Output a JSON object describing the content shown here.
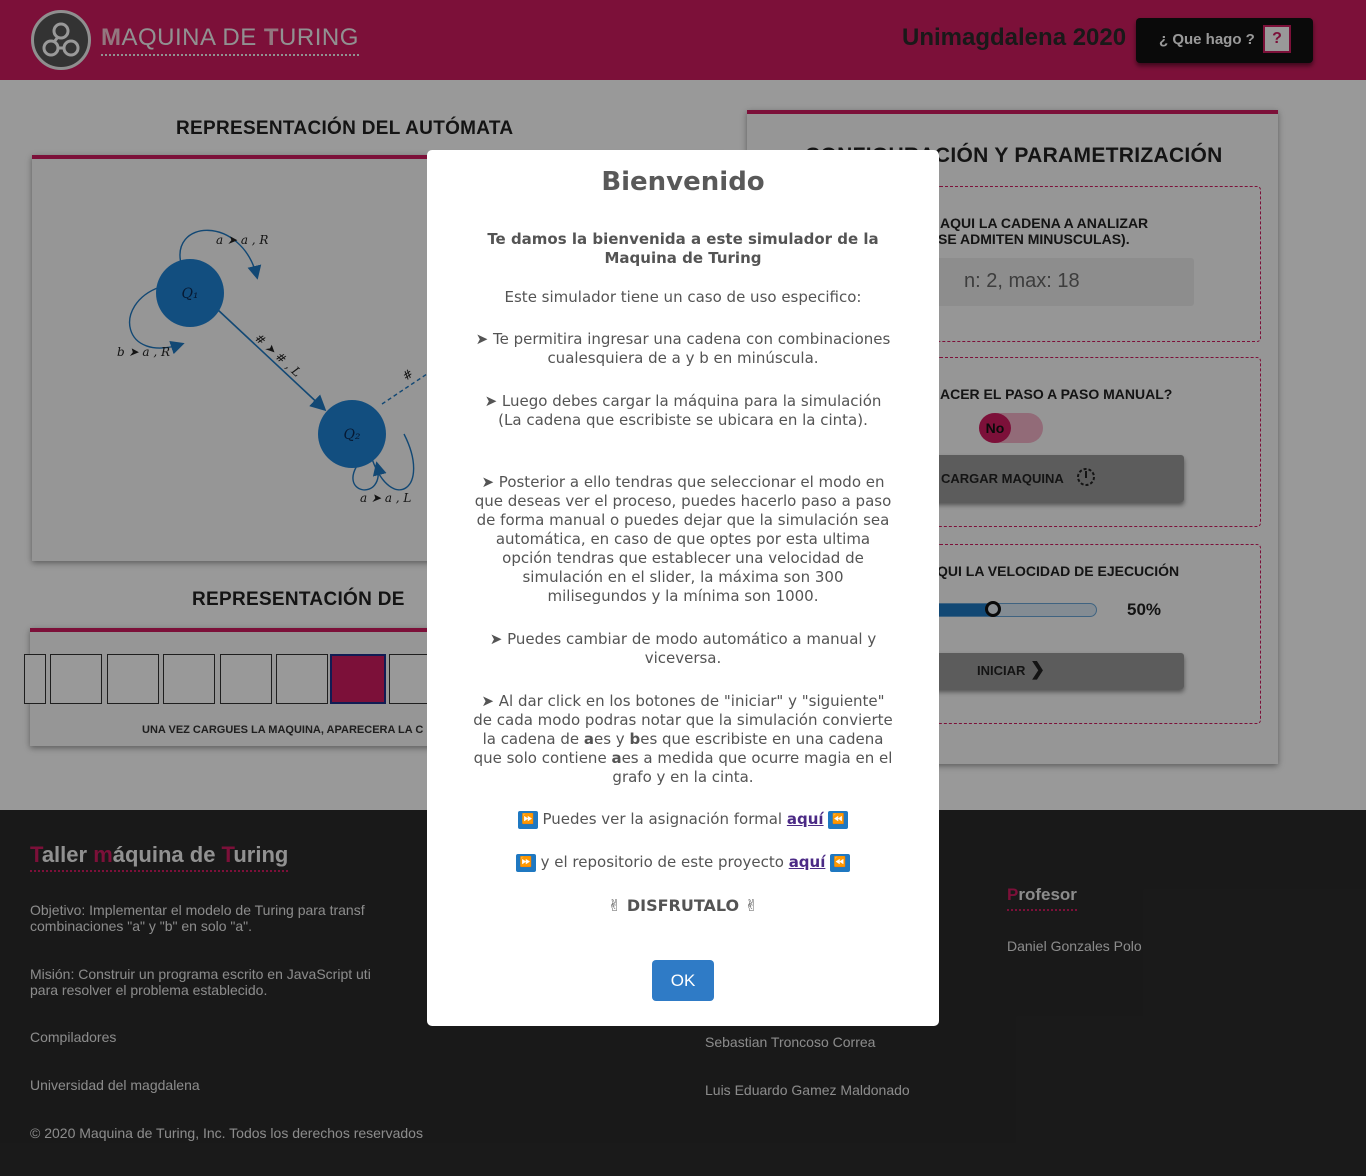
{
  "header": {
    "brand_prefix": "M",
    "brand_mid": "AQUINA DE ",
    "brand_t": "T",
    "brand_rest": "URING",
    "uni_label": "Unimagdalena 2020",
    "help_label": "¿ Que hago ?",
    "help_icon": "?"
  },
  "graph": {
    "title": "REPRESENTACIÓN DEL AUTÓMATA",
    "q1": "Q₁",
    "q2": "Q₂",
    "loop_q1_top": "a ➤ a , R",
    "loop_q1_left": "b ➤ a , R",
    "edge_q1_q2": "# ➤ # , L",
    "loop_q2": "a ➤ a , L",
    "edge_q2_out": "#"
  },
  "tape": {
    "title": "REPRESENTACIÓN DE",
    "note": "UNA VEZ CARGUES LA MAQUINA, APARECERA LA C"
  },
  "config": {
    "title": "CONFIGURACIÓN Y PARAMETRIZACIÓN",
    "input_label_1": "AQUI LA CADENA A ANALIZAR",
    "input_label_2": "SE ADMITEN MINUSCULAS).",
    "input_placeholder": "n: 2, max: 18",
    "manual_label": "ACER EL PASO A PASO MANUAL?",
    "toggle_value": "No",
    "load_button": "CARGAR MAQUINA",
    "speed_label": "QUI LA VELOCIDAD DE EJECUCIÓN",
    "speed_value": "50%",
    "speed_fraction": 0.5,
    "start_button": "INICIAR"
  },
  "footer": {
    "title_t": "T",
    "title_aller": "aller ",
    "title_m": "m",
    "title_aquina": "áquina de ",
    "title_t2": "T",
    "title_uring": "uring",
    "objective_1": "Objetivo: Implementar el modelo de Turing para transf",
    "objective_2": "combinaciones \"a\" y \"b\" en solo \"a\".",
    "mission_1": "Misión: Construir un programa escrito en JavaScript uti",
    "mission_2": "para resolver el problema establecido.",
    "course": "Compiladores",
    "university": "Universidad del magdalena",
    "copyright": "© 2020 Maquina de Turing, Inc. Todos los derechos reservados",
    "student_1": "Sebastian Troncoso Correa",
    "student_2": "Luis Eduardo Gamez Maldonado",
    "prof_p": "P",
    "prof_rest": "rofesor",
    "prof_name": "Daniel Gonzales Polo"
  },
  "modal": {
    "title": "Bienvenido",
    "intro_bold": "Te damos la bienvenida a este simulador de la Maquina de Turing",
    "intro": "Este simulador tiene un caso de uso especifico:",
    "p1": "➤ Te permitira ingresar una cadena con combinaciones cualesquiera de a y b en minúscula.",
    "p2": "➤ Luego debes cargar la máquina para la simulación (La cadena que escribiste se ubicara en la cinta).",
    "p3": "➤ Posterior a ello tendras que seleccionar el modo en que deseas ver el proceso, puedes hacerlo paso a paso de forma manual o puedes dejar que la simulación sea automática, en caso de que optes por esta ultima opción tendras que establecer una velocidad de simulación en el slider, la máxima son 300 milisegundos y la mínima son 1000.",
    "p4": "➤ Puedes cambiar de modo automático a manual y viceversa.",
    "p5_a": "➤ Al dar click en los botones de \"iniciar\" y \"siguiente\" de cada modo podras notar que la simulación convierte la cadena de ",
    "p5_a_bold": "a",
    "p5_b": "es y ",
    "p5_b_bold": "b",
    "p5_c": "es que escribiste en una cadena que solo contiene ",
    "p5_c_bold": "a",
    "p5_d": "es a medida que ocurre magia en el grafo y en la cinta.",
    "formal_text": "Puedes ver la asignación formal",
    "repo_text": "y el repositorio de este proyecto",
    "link_text": "aquí",
    "enjoy": "✌ DISFRUTALO ✌",
    "ok": "OK"
  }
}
